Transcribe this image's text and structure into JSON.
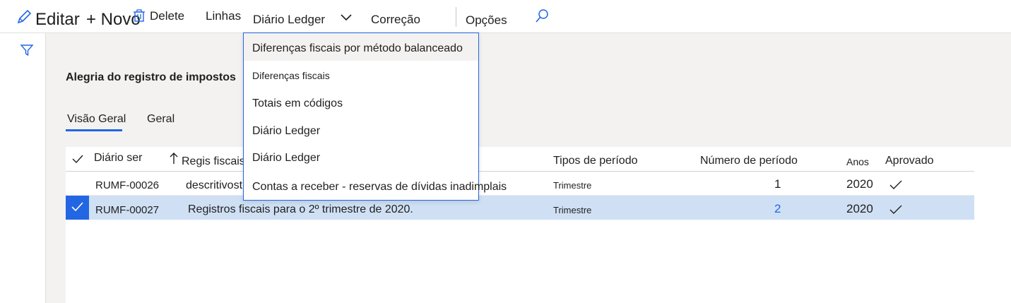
{
  "toolbar": {
    "edit_label": "Editar",
    "new_label": "+ Novo",
    "delete_label": "Delete",
    "lines_label": "Linhas",
    "ledger_label": "Diário Ledger",
    "correction_label": "Correção",
    "options_label": "Opções",
    "icons": {
      "edit": "pencil-icon",
      "delete": "trash-icon",
      "dropdown": "chevron-down-icon",
      "search": "search-icon"
    }
  },
  "sidebar": {
    "filter_icon": "filter-icon"
  },
  "page": {
    "title": "Alegria do registro de impostos",
    "tabs": [
      {
        "label": "Visão Geral",
        "active": true
      },
      {
        "label": "Geral",
        "active": false
      }
    ]
  },
  "dropdown": {
    "items": [
      "Diferenças fiscais por método balanceado",
      "Diferenças fiscais",
      "Totais em códigos",
      "Diário Ledger",
      "Diário Ledger",
      "Contas a receber - reservas de dívidas inadimplais"
    ]
  },
  "grid": {
    "headers": {
      "journal": "Diário ser",
      "register": "Regis fiscais",
      "period_type": "Tipos de período",
      "period_number": "Número de período",
      "years": "Anos",
      "approved": "Aprovado"
    },
    "rows": [
      {
        "journal": "RUMF-00026",
        "description": "descritivost",
        "period_type": "Trimestre",
        "period_number": "1",
        "year": "2020",
        "approved": true,
        "selected": false
      },
      {
        "journal": "RUMF-00027",
        "description": "Registros fiscais para o 2º trimestre de 2020.",
        "period_type": "Trimestre",
        "period_number": "2",
        "year": "2020",
        "approved": true,
        "selected": true
      }
    ]
  },
  "colors": {
    "accent": "#2266e3",
    "selected_row": "#cfe0f4",
    "workspace": "#f3f2f1"
  }
}
